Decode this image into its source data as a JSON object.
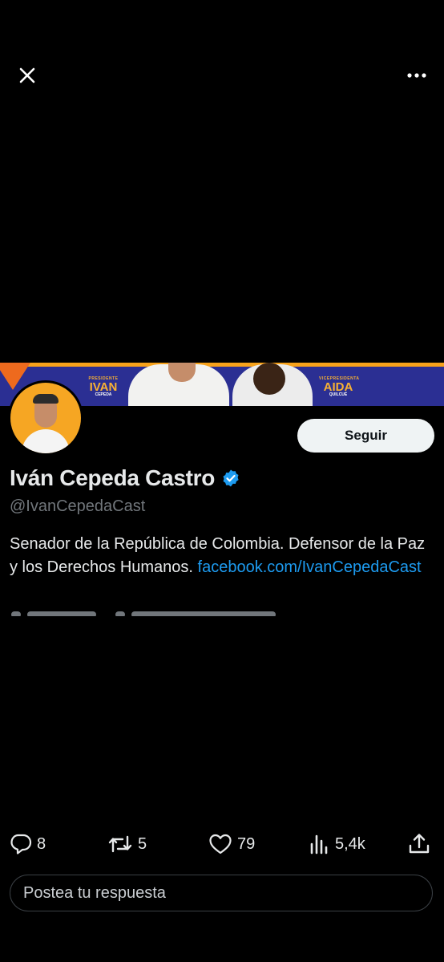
{
  "top_bar": {
    "close_icon": "close-icon",
    "more_icon": "more-horizontal-icon"
  },
  "banner": {
    "left_small": "PRESIDENTE",
    "left_name": "IVAN",
    "left_sub": "CEPEDA",
    "right_small": "VICEPRESIDENTA",
    "right_name": "AIDA",
    "right_sub": "QUILCUÉ"
  },
  "profile": {
    "name": "Iván Cepeda Castro",
    "handle": "@IvanCepedaCast",
    "verified": true,
    "bio_text": "Senador de la República de Colombia. Defensor de la Paz y los Derechos Humanos. ",
    "bio_link": "facebook.com/IvanCepedaCast",
    "follow_label": "Seguir"
  },
  "actions": {
    "replies": "8",
    "reposts": "5",
    "likes": "79",
    "views": "5,4k"
  },
  "reply": {
    "placeholder": "Postea tu respuesta"
  },
  "colors": {
    "accent": "#1d9bf0",
    "background": "#000000",
    "avatar_bg": "#f6a623"
  }
}
